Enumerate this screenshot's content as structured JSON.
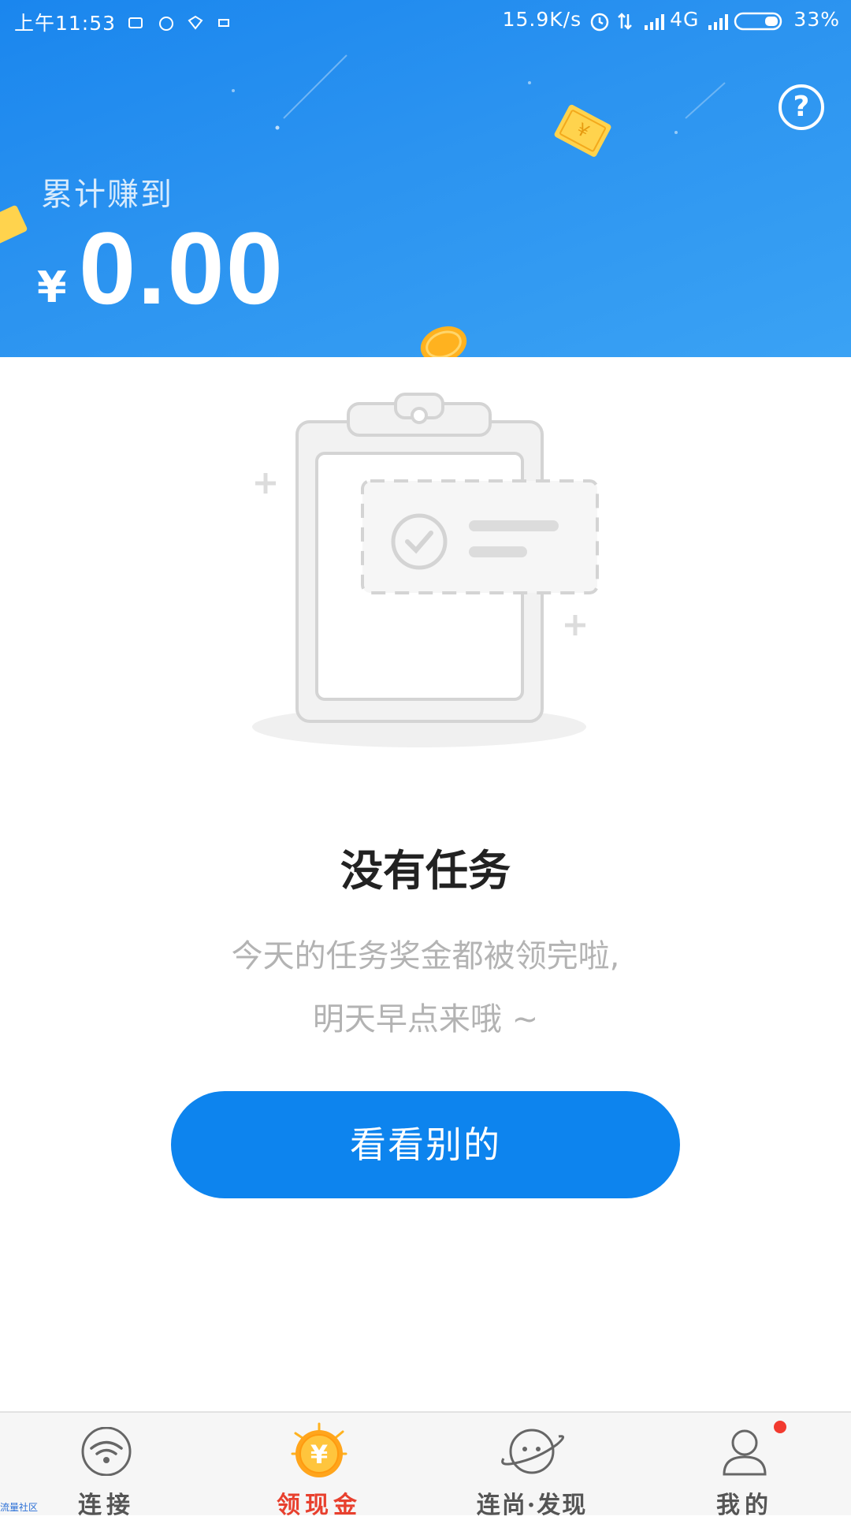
{
  "status_bar": {
    "time": "上午11:53",
    "network_speed": "15.9K/s",
    "network_type": "4G",
    "battery": "33%"
  },
  "header": {
    "earned_label": "累计赚到",
    "currency_symbol": "¥",
    "amount": "0.00",
    "help_icon_label": "?"
  },
  "empty_state": {
    "title": "没有任务",
    "description_line1": "今天的任务奖金都被领完啦,",
    "description_line2": "明天早点来哦 ~",
    "button_label": "看看别的"
  },
  "bottom_nav": {
    "items": [
      {
        "label": "连接",
        "icon": "wifi-icon",
        "active": false
      },
      {
        "label": "领现金",
        "icon": "coin-icon",
        "active": true
      },
      {
        "label": "连尚·发现",
        "icon": "planet-icon",
        "active": false
      },
      {
        "label": "我的",
        "icon": "user-icon",
        "active": false,
        "has_badge": true
      }
    ]
  },
  "watermark": "流量社区",
  "colors": {
    "header_blue": "#2b93f0",
    "button_blue": "#0d84ee",
    "active_nav": "#e8402e",
    "badge_red": "#f23a2f"
  }
}
